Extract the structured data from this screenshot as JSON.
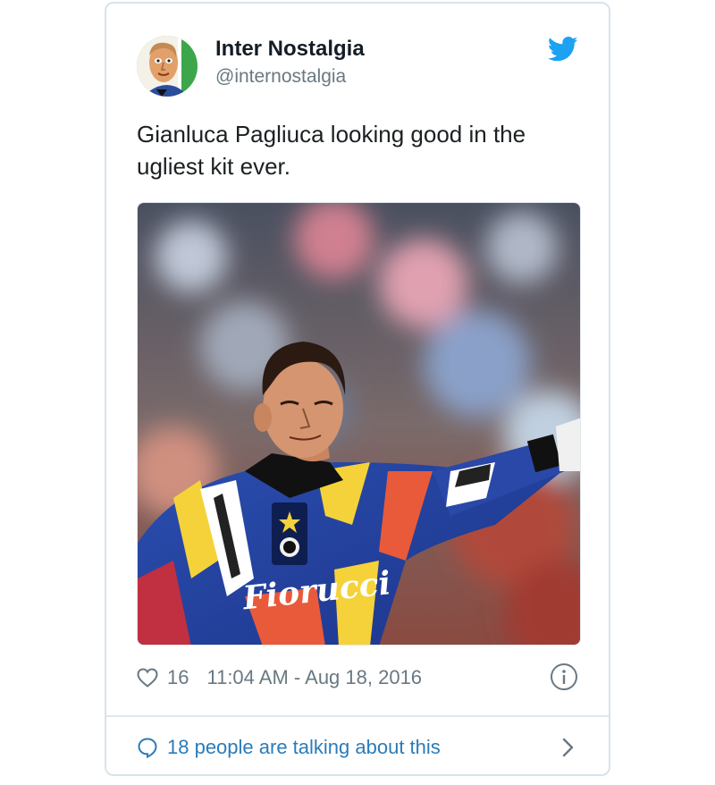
{
  "tweet": {
    "author": {
      "name": "Inter Nostalgia",
      "handle": "@internostalgia",
      "avatar_icon": "cartoon-face-avatar"
    },
    "brand_icon": "twitter-bird-icon",
    "text": "Gianluca Pagliuca looking good in the ugliest kit ever.",
    "media": {
      "description_icon": "goalkeeper-photo",
      "shirt_text": "Fiorucci"
    },
    "likes": "16",
    "timestamp": "11:04 AM - Aug 18, 2016",
    "conversation_label": "18 people are talking about this"
  },
  "colors": {
    "twitter_blue": "#1da1f2",
    "link_blue": "#2b7bb9",
    "meta_gray": "#697882",
    "border": "#d8e3ea"
  }
}
